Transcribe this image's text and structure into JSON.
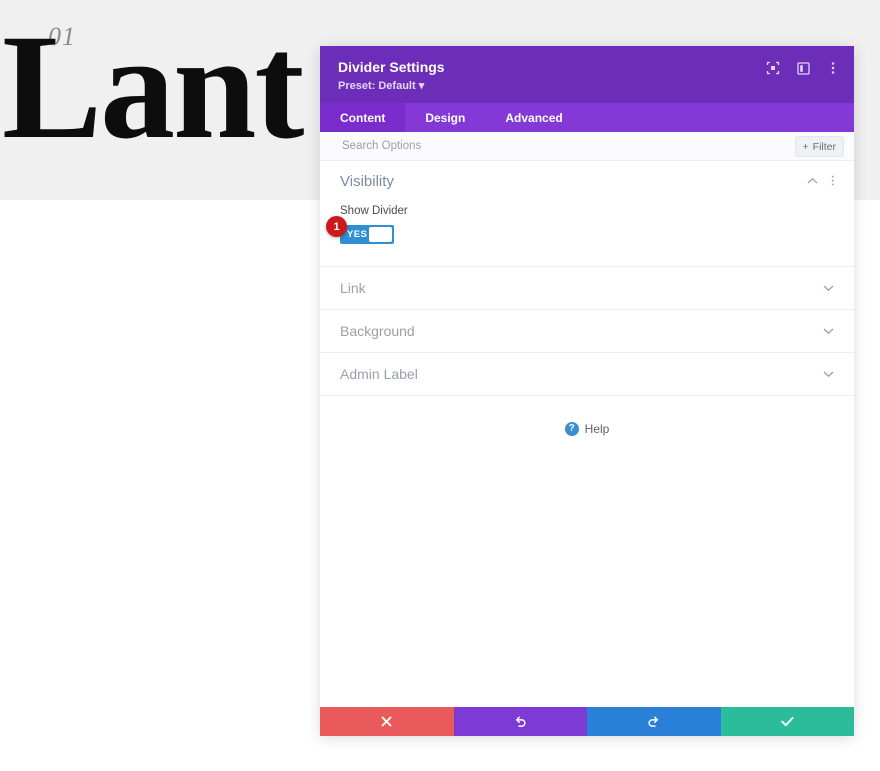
{
  "page_background": {
    "hero_number": "01",
    "hero_word": "Lant",
    "band_color": "#f0f0f0"
  },
  "panel": {
    "title": "Divider Settings",
    "preset": "Preset: Default ▾",
    "header_icons": [
      {
        "name": "focus-target-icon"
      },
      {
        "name": "split-view-icon"
      },
      {
        "name": "more-vertical-icon"
      }
    ],
    "tabs": [
      {
        "label": "Content",
        "active": true
      },
      {
        "label": "Design",
        "active": false
      },
      {
        "label": "Advanced",
        "active": false
      }
    ],
    "search": {
      "placeholder": "Search Options",
      "value": ""
    },
    "filter_button": {
      "label": "Filter",
      "plus": "+"
    },
    "open_section": {
      "title": "Visibility",
      "field_label": "Show Divider",
      "toggle": {
        "state_label": "YES",
        "on": true,
        "accent_color": "#2e8fd4"
      },
      "step_badge": "1"
    },
    "collapsed_sections": [
      {
        "title": "Link"
      },
      {
        "title": "Background"
      },
      {
        "title": "Admin Label"
      }
    ],
    "help": {
      "label": "Help",
      "icon_glyph": "?"
    },
    "footer_buttons": [
      {
        "name": "cancel-button",
        "icon": "close-icon",
        "color": "#eb5a5a"
      },
      {
        "name": "undo-button",
        "icon": "undo-icon",
        "color": "#7e3ad4"
      },
      {
        "name": "redo-button",
        "icon": "redo-icon",
        "color": "#2980d6"
      },
      {
        "name": "save-button",
        "icon": "check-icon",
        "color": "#2bbd9a"
      }
    ],
    "colors": {
      "header": "#6c2eb9",
      "tabbar": "#8439d6",
      "tab_active": "#7a2dcc",
      "badge_red": "#cc1a1a"
    }
  }
}
